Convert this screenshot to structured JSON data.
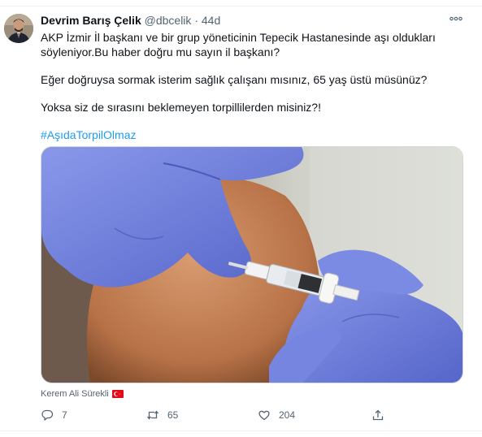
{
  "tweet": {
    "author_name": "Devrim Barış Çelik",
    "handle": "@dbcelik",
    "separator": "·",
    "time": "44d",
    "paragraphs": [
      "AKP İzmir İl başkanı ve bir grup yöneticinin Tepecik Hastanesinde aşı oldukları söyleniyor.Bu haber doğru mu sayın il başkanı?",
      "Eğer doğruysa sormak isterim sağlık çalışanı mısınız, 65 yaş üstü müsünüz?",
      "Yoksa siz de sırasını beklemeyen torpillilerden misiniz?!"
    ],
    "hashtag": "#AşıdaTorpilOlmaz",
    "media_credit": "Kerem Ali Sürekli",
    "credit_flag_icon": "turkey-flag-icon",
    "actions": {
      "replies": "7",
      "retweets": "65",
      "likes": "204"
    },
    "icons": {
      "more": "more-dots-icon",
      "reply": "reply-icon",
      "retweet": "retweet-icon",
      "like": "heart-icon",
      "share": "share-icon"
    },
    "colors": {
      "accent": "#1d9bf0",
      "secondary_text": "#536471",
      "glove": "#6f7fd8"
    }
  }
}
